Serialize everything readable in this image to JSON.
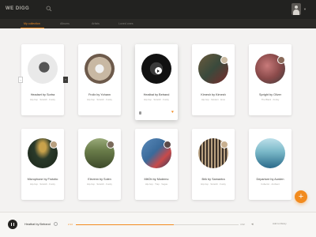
{
  "header": {
    "logo": "WE DIGG"
  },
  "tabs": [
    {
      "label": "My collection",
      "active": true
    },
    {
      "label": "Albums"
    },
    {
      "label": "Artists"
    },
    {
      "label": "Loved ones"
    }
  ],
  "cards": [
    {
      "title": "Headset by Sortra",
      "sub": "Hip-hop · Scratch · Funky",
      "art": [
        "#efefef",
        "#2b2b2b"
      ]
    },
    {
      "title": "Frolix by Yohann",
      "sub": "Hip-hop · Scratch · Funky",
      "art": [
        "#c8b8a3",
        "#6d5a4b"
      ]
    },
    {
      "title": "Heatbat by Betrand",
      "sub": "Hip-hop · Scratch · Funky",
      "art": [
        "#1a1a1a",
        "#2b2b2b"
      ],
      "expanded": true
    },
    {
      "title": "Kimesh by Kimesh",
      "sub": "Hip-hop · Modern · Emo",
      "art": [
        "#3a4a3c",
        "#6b5a3d"
      ]
    },
    {
      "title": "Spright by Oliver",
      "sub": "The Black · Funky",
      "art": [
        "#8a4a4a",
        "#3a3a3a"
      ]
    },
    {
      "title": "Microphone by Frototio",
      "sub": "Hip-hop · Scratch · Funky",
      "art": [
        "#2a3a2a",
        "#c8a24b"
      ]
    },
    {
      "title": "Elevenn by Solen",
      "sub": "Hip-hop · Scratch · Funky",
      "art": [
        "#6a7d4a",
        "#3d4a2a"
      ]
    },
    {
      "title": "MitOb by Modemo",
      "sub": "Hip-hop · Trap · Vegas",
      "art": [
        "#3a6a9a",
        "#2a3a5a"
      ]
    },
    {
      "title": "Brik by Samantra",
      "sub": "Hip-hop · Scratch · Funky",
      "art": [
        "#3a3028",
        "#b8a080"
      ]
    },
    {
      "title": "Departure by Aurden",
      "sub": "Collector · Ambient",
      "art": [
        "#7ab8c8",
        "#2a6a8a"
      ]
    }
  ],
  "player": {
    "now_playing": "Heatbat by Betrand",
    "time_elapsed": "2:14",
    "time_total": "4:32",
    "progress": 0.6,
    "add_label": "Add to library"
  },
  "colors": {
    "accent": "#f28b1f",
    "topbar": "#222220"
  }
}
